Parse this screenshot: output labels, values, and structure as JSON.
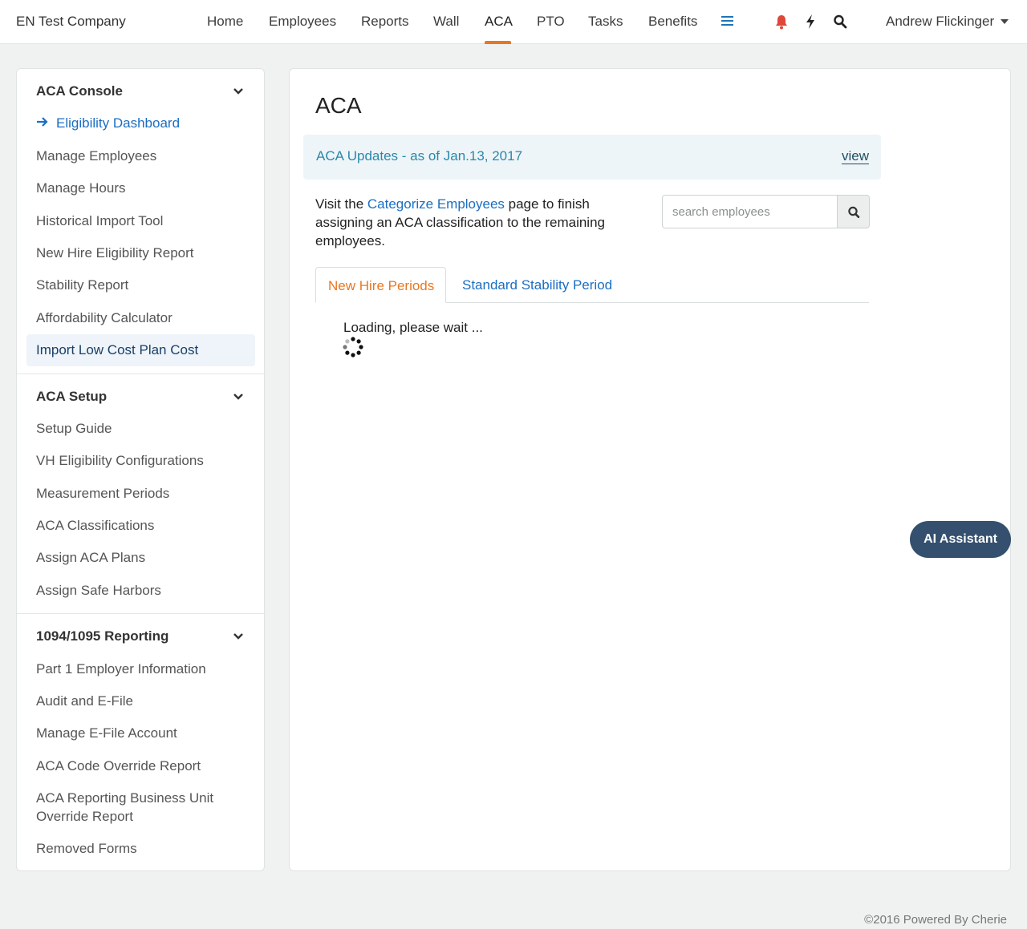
{
  "header": {
    "company": "EN Test Company",
    "nav": [
      {
        "label": "Home"
      },
      {
        "label": "Employees"
      },
      {
        "label": "Reports"
      },
      {
        "label": "Wall"
      },
      {
        "label": "ACA",
        "active": true
      },
      {
        "label": "PTO"
      },
      {
        "label": "Tasks"
      },
      {
        "label": "Benefits"
      }
    ],
    "user_name": "Andrew Flickinger",
    "accent_color": "#e87722"
  },
  "sidebar": {
    "sections": [
      {
        "title": "ACA Console",
        "items": [
          {
            "label": "Eligibility Dashboard",
            "current": true
          },
          {
            "label": "Manage Employees"
          },
          {
            "label": "Manage Hours"
          },
          {
            "label": "Historical Import Tool"
          },
          {
            "label": "New Hire Eligibility Report"
          },
          {
            "label": "Stability Report"
          },
          {
            "label": "Affordability Calculator"
          },
          {
            "label": "Import Low Cost Plan Cost",
            "highlighted": true
          }
        ]
      },
      {
        "title": "ACA Setup",
        "items": [
          {
            "label": "Setup Guide"
          },
          {
            "label": "VH Eligibility Configurations"
          },
          {
            "label": "Measurement Periods"
          },
          {
            "label": "ACA Classifications"
          },
          {
            "label": "Assign ACA Plans"
          },
          {
            "label": "Assign Safe Harbors"
          }
        ]
      },
      {
        "title": "1094/1095 Reporting",
        "items": [
          {
            "label": "Part 1 Employer Information"
          },
          {
            "label": "Audit and E-File"
          },
          {
            "label": "Manage E-File Account"
          },
          {
            "label": "ACA Code Override Report"
          },
          {
            "label": "ACA Reporting Business Unit Override Report"
          },
          {
            "label": "Removed Forms"
          }
        ]
      }
    ]
  },
  "main": {
    "title": "ACA",
    "updates": {
      "text": "ACA Updates - as of Jan.13, 2017",
      "link": "view"
    },
    "visit": {
      "before": "Visit the ",
      "link": "Categorize Employees",
      "after": " page to finish assigning an ACA classification to the remaining employees."
    },
    "search": {
      "placeholder": "search employees",
      "value": ""
    },
    "tabs": [
      {
        "label": "New Hire Periods",
        "active": true
      },
      {
        "label": "Standard Stability Period"
      }
    ],
    "loading_text": "Loading, please wait ..."
  },
  "ai_assistant": {
    "label": "AI Assistant"
  },
  "footer": {
    "text": "©2016 Powered By Cherie"
  }
}
